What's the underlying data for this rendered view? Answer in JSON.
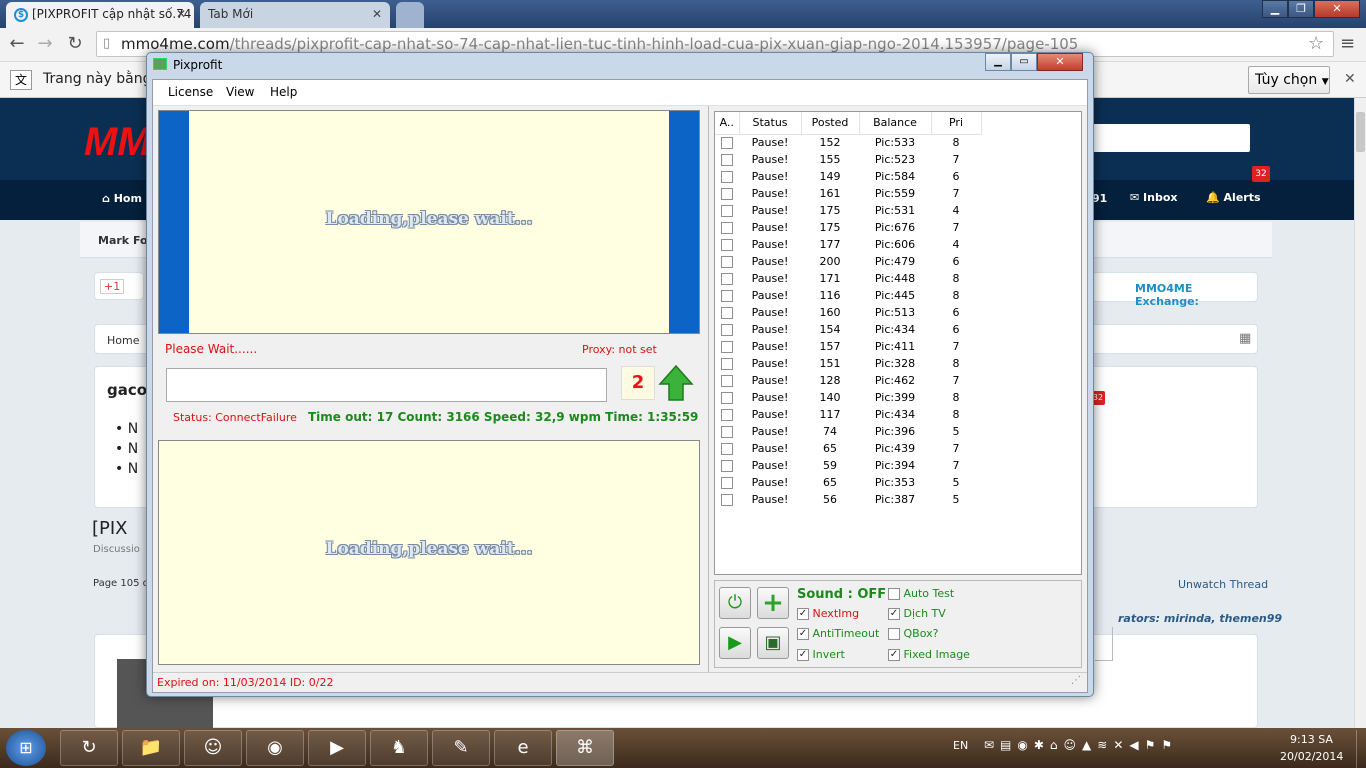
{
  "browser": {
    "tabs": [
      {
        "title": "[PIXPROFIT cập nhật số.74",
        "active": true
      },
      {
        "title": "Tab Mới",
        "active": false
      }
    ],
    "url_host": "mmo4me.com",
    "url_path": "/threads/pixprofit-cap-nhat-so-74-cap-nhat-lien-tuc-tinh-hinh-load-cua-pix-xuan-giap-ngo-2014.153957/page-105",
    "translate_text": "Trang này bằng",
    "options_label": "Tùy chọn"
  },
  "site": {
    "nav_home": "Hom",
    "nav_num": "91",
    "inbox": "Inbox",
    "alerts": "Alerts",
    "alerts_badge": "32",
    "mark_forums": "Mark Fo",
    "gplus": "+1",
    "exchange": "MMO4ME Exchange:",
    "breadcrumb_home": "Home",
    "user_partial": "gaco",
    "badge2": "32",
    "thread_title_partial": "[PIX",
    "discussion_partial": "Discussio",
    "page_partial": "Page 105 o",
    "unwatch": "Unwatch Thread",
    "moderators": "rators: mirinda, themen99"
  },
  "app": {
    "title": "Pixprofit",
    "menu": [
      "License",
      "View",
      "Help"
    ],
    "loading_text": "Loading,please wait...",
    "please_wait": "Please Wait......",
    "proxy": "Proxy: not set",
    "counter": "2",
    "status": "Status: ConnectFailure",
    "stats": "Time out: 17  Count: 3166  Speed: 32,9 wpm  Time: 1:35:59",
    "expired": "Expired on: 11/03/2014   ID: 0/22",
    "sound": "Sound : OFF",
    "options": {
      "nextimg": "NextImg",
      "antitimeout": "AntiTimeout",
      "invert": "Invert",
      "autotest": "Auto Test",
      "dichtv": "Dịch TV",
      "qbox": "QBox?",
      "fixedimage": "Fixed Image"
    },
    "table": {
      "headers": [
        "A..",
        "Status",
        "Posted",
        "Balance",
        "Pri"
      ],
      "rows": [
        {
          "status": "Pause!",
          "posted": "152",
          "balance": "Pic:533",
          "pri": "8"
        },
        {
          "status": "Pause!",
          "posted": "155",
          "balance": "Pic:523",
          "pri": "7"
        },
        {
          "status": "Pause!",
          "posted": "149",
          "balance": "Pic:584",
          "pri": "6"
        },
        {
          "status": "Pause!",
          "posted": "161",
          "balance": "Pic:559",
          "pri": "7"
        },
        {
          "status": "Pause!",
          "posted": "175",
          "balance": "Pic:531",
          "pri": "4"
        },
        {
          "status": "Pause!",
          "posted": "175",
          "balance": "Pic:676",
          "pri": "7"
        },
        {
          "status": "Pause!",
          "posted": "177",
          "balance": "Pic:606",
          "pri": "4"
        },
        {
          "status": "Pause!",
          "posted": "200",
          "balance": "Pic:479",
          "pri": "6"
        },
        {
          "status": "Pause!",
          "posted": "171",
          "balance": "Pic:448",
          "pri": "8"
        },
        {
          "status": "Pause!",
          "posted": "116",
          "balance": "Pic:445",
          "pri": "8"
        },
        {
          "status": "Pause!",
          "posted": "160",
          "balance": "Pic:513",
          "pri": "6"
        },
        {
          "status": "Pause!",
          "posted": "154",
          "balance": "Pic:434",
          "pri": "6"
        },
        {
          "status": "Pause!",
          "posted": "157",
          "balance": "Pic:411",
          "pri": "7"
        },
        {
          "status": "Pause!",
          "posted": "151",
          "balance": "Pic:328",
          "pri": "8"
        },
        {
          "status": "Pause!",
          "posted": "128",
          "balance": "Pic:462",
          "pri": "7"
        },
        {
          "status": "Pause!",
          "posted": "140",
          "balance": "Pic:399",
          "pri": "8"
        },
        {
          "status": "Pause!",
          "posted": "117",
          "balance": "Pic:434",
          "pri": "8"
        },
        {
          "status": "Pause!",
          "posted": "74",
          "balance": "Pic:396",
          "pri": "5"
        },
        {
          "status": "Pause!",
          "posted": "65",
          "balance": "Pic:439",
          "pri": "7"
        },
        {
          "status": "Pause!",
          "posted": "59",
          "balance": "Pic:394",
          "pri": "7"
        },
        {
          "status": "Pause!",
          "posted": "65",
          "balance": "Pic:353",
          "pri": "5"
        },
        {
          "status": "Pause!",
          "posted": "56",
          "balance": "Pic:387",
          "pri": "5"
        }
      ]
    }
  },
  "taskbar": {
    "lang": "EN",
    "time": "9:13 SA",
    "date": "20/02/2014"
  }
}
